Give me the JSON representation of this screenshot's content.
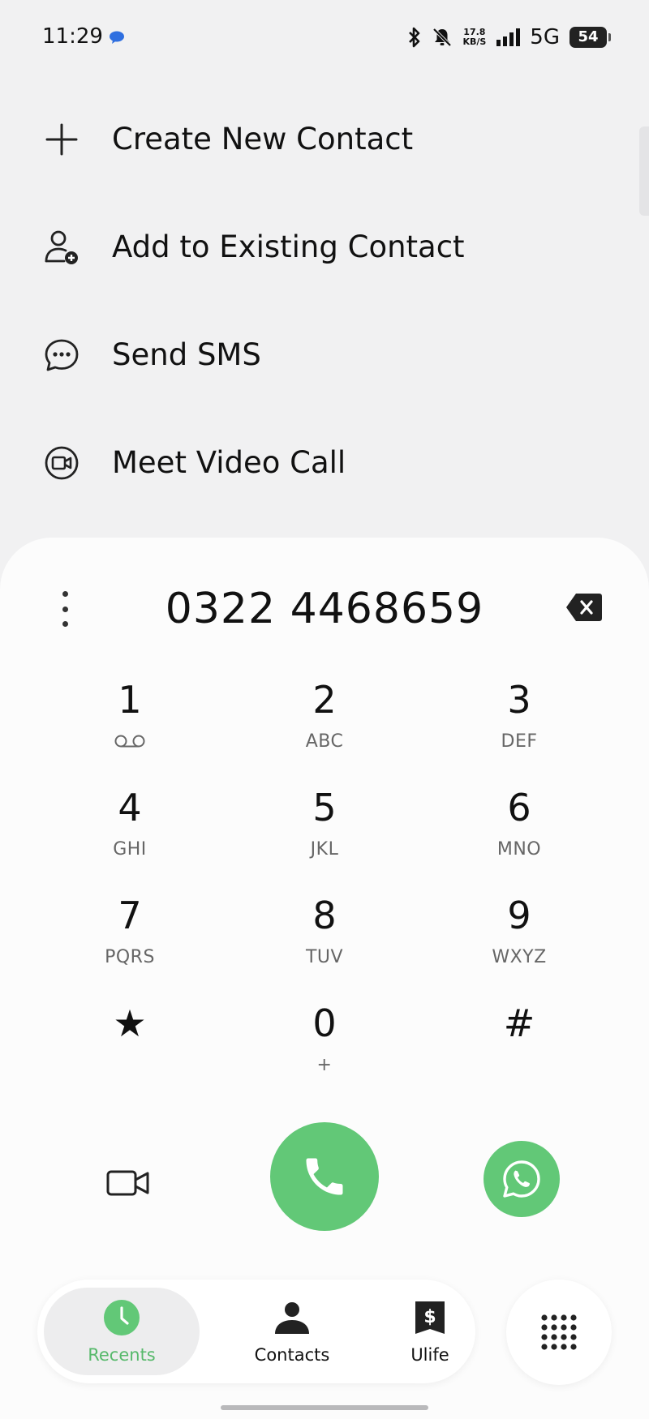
{
  "status_bar": {
    "time": "11:29",
    "net_speed_value": "17.8",
    "net_speed_unit": "KB/S",
    "network": "5G",
    "battery": "54"
  },
  "menu": {
    "items": [
      {
        "label": "Create New Contact",
        "icon": "plus-icon"
      },
      {
        "label": "Add to Existing Contact",
        "icon": "person-add-icon"
      },
      {
        "label": "Send SMS",
        "icon": "message-icon"
      },
      {
        "label": "Meet Video Call",
        "icon": "meet-video-icon"
      }
    ]
  },
  "dialer": {
    "number": "0322 4468659",
    "keys": [
      {
        "digit": "1",
        "sub": ""
      },
      {
        "digit": "2",
        "sub": "ABC"
      },
      {
        "digit": "3",
        "sub": "DEF"
      },
      {
        "digit": "4",
        "sub": "GHI"
      },
      {
        "digit": "5",
        "sub": "JKL"
      },
      {
        "digit": "6",
        "sub": "MNO"
      },
      {
        "digit": "7",
        "sub": "PQRS"
      },
      {
        "digit": "8",
        "sub": "TUV"
      },
      {
        "digit": "9",
        "sub": "WXYZ"
      },
      {
        "digit": "★",
        "sub": ""
      },
      {
        "digit": "0",
        "sub": "+"
      },
      {
        "digit": "#",
        "sub": ""
      }
    ]
  },
  "nav": {
    "recents": "Recents",
    "contacts": "Contacts",
    "ulife": "Ulife"
  },
  "colors": {
    "accent_green": "#62c877",
    "active_label_green": "#57b96b",
    "background": "#f1f1f2",
    "card": "#fcfcfc"
  }
}
